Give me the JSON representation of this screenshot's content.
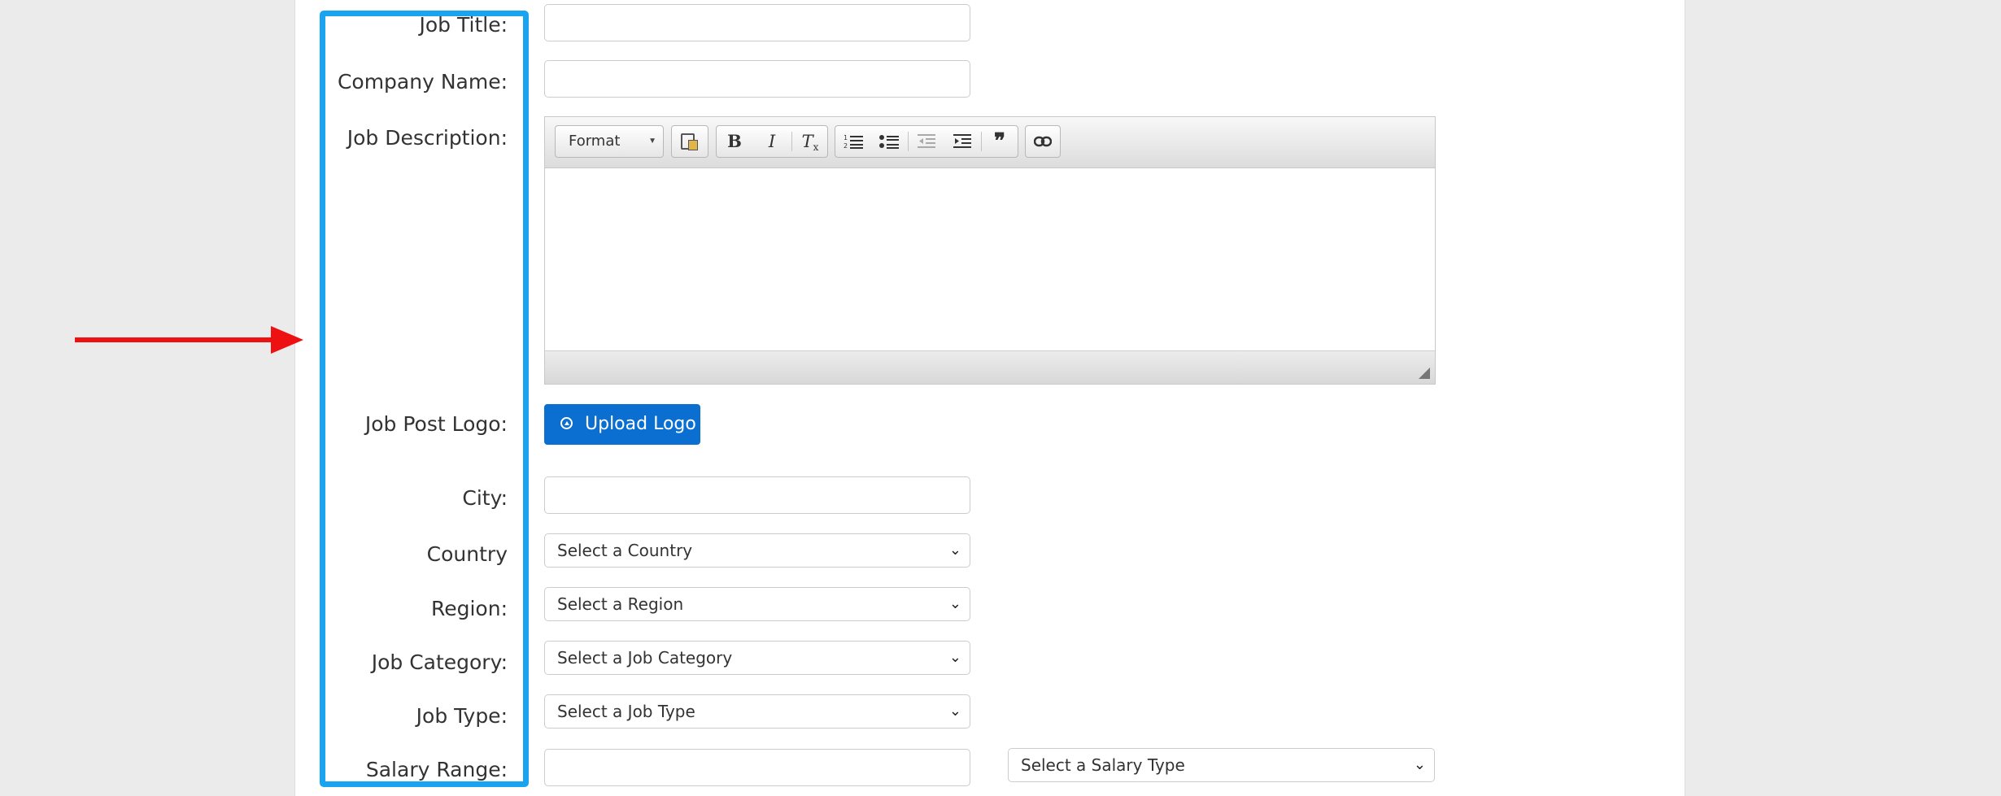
{
  "form": {
    "labels": {
      "job_title": "Job Title:",
      "company_name": "Company Name:",
      "job_description": "Job Description:",
      "job_post_logo": "Job Post Logo:",
      "city": "City:",
      "country": "Country",
      "region": "Region:",
      "job_category": "Job Category:",
      "job_type": "Job Type:",
      "salary_range": "Salary Range:"
    },
    "values": {
      "job_title": "",
      "company_name": "",
      "city": "",
      "salary_range": ""
    },
    "selects": {
      "country": "Select a Country",
      "region": "Select a Region",
      "job_category": "Select a Job Category",
      "job_type": "Select a Job Type",
      "salary_type": "Select a Salary Type"
    },
    "upload_button": "Upload Logo"
  },
  "editor": {
    "format_label": "Format",
    "toolbar_icons": [
      "paste-from-word-icon",
      "bold-icon",
      "italic-icon",
      "remove-format-icon",
      "numbered-list-icon",
      "bulleted-list-icon",
      "decrease-indent-icon",
      "increase-indent-icon",
      "blockquote-icon",
      "link-icon"
    ],
    "bold": "B",
    "italic": "I",
    "remove_format": "T",
    "blockquote": "❞",
    "content": ""
  },
  "annotation": {
    "highlight_color": "#1aa3f0",
    "arrow_color": "#ee1111"
  },
  "colors": {
    "primary_button": "#0b6fd1",
    "page_background": "#ebebeb"
  }
}
